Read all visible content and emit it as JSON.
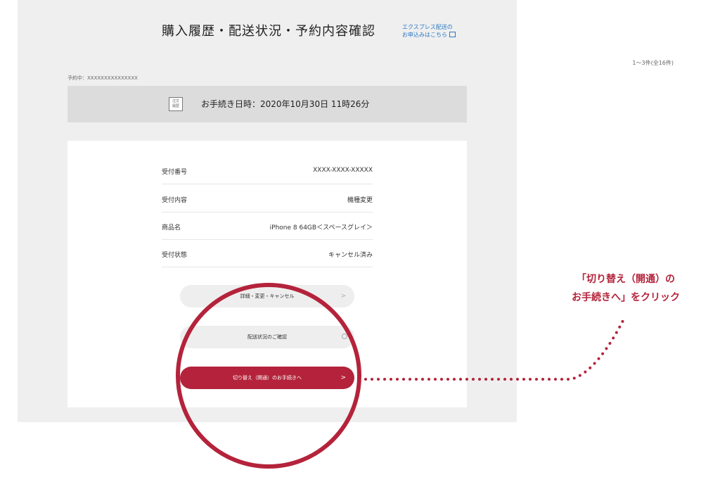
{
  "header": {
    "title": "購入履歴・配送状況・予約内容確認",
    "express_link_line1": "エクスプレス配送の",
    "express_link_line2": "お申込みはこちら",
    "count": "1〜3件(全16件)"
  },
  "reservation": {
    "label": "予約中：XXXXXXXXXXXXXXX",
    "badge_line1": "注文",
    "badge_line2": "履歴",
    "datetime": "お手続き日時：2020年10月30日 11時26分"
  },
  "details": [
    {
      "label": "受付番号",
      "value": "XXXX-XXXX-XXXXX"
    },
    {
      "label": "受付内容",
      "value": "機種変更"
    },
    {
      "label": "商品名",
      "value": "iPhone 8 64GB＜スペースグレイ＞"
    },
    {
      "label": "受付状態",
      "value": "キャンセル済み"
    }
  ],
  "buttons": {
    "detail": "詳細・変更・キャンセル",
    "delivery": "配送状況のご確認",
    "switch": "切り替え（開通）のお手続きへ"
  },
  "annotation": {
    "line1": "「切り替え（開通）の",
    "line2": "お手続きへ」をクリック"
  },
  "colors": {
    "accent": "#b4233b",
    "link": "#2b78c5",
    "panel_bg": "#efefef"
  }
}
